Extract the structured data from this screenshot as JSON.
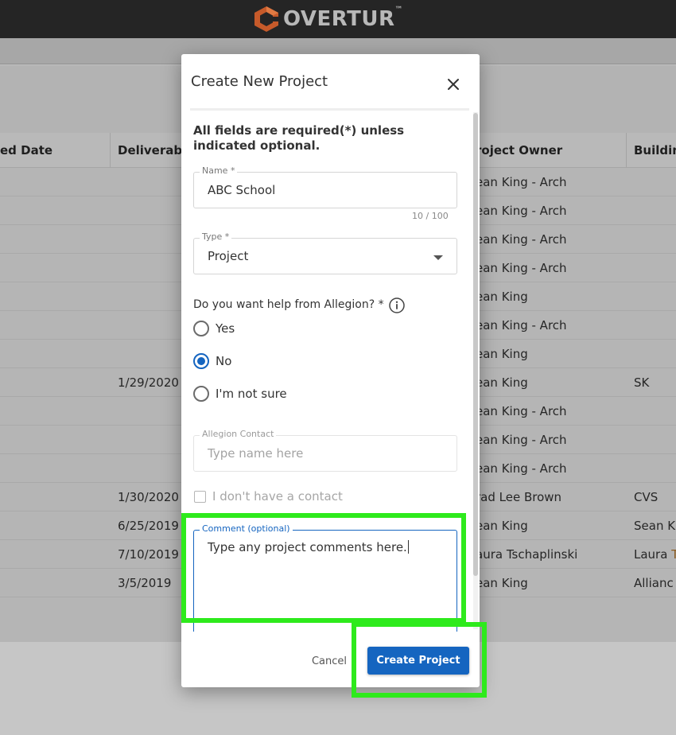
{
  "app": {
    "brand": "OVERTUR",
    "trademark": "™",
    "brand_color": "#c65a2a"
  },
  "table": {
    "headers": [
      "ed Date",
      "Deliverabl",
      "roject Owner",
      "Buildin"
    ],
    "rows": [
      {
        "deliverable": "",
        "owner": "ean King - Arch",
        "building": ""
      },
      {
        "deliverable": "",
        "owner": "ean King - Arch",
        "building": ""
      },
      {
        "deliverable": "",
        "owner": "ean King - Arch",
        "building": ""
      },
      {
        "deliverable": "",
        "owner": "ean King - Arch",
        "building": ""
      },
      {
        "deliverable": "",
        "owner": "ean King",
        "building": ""
      },
      {
        "deliverable": "",
        "owner": "ean King - Arch",
        "building": ""
      },
      {
        "deliverable": "",
        "owner": "ean King",
        "building": ""
      },
      {
        "deliverable": "1/29/2020",
        "owner": "ean King",
        "building": "SK"
      },
      {
        "deliverable": "",
        "owner": "ean King - Arch",
        "building": ""
      },
      {
        "deliverable": "",
        "owner": "ean King - Arch",
        "building": ""
      },
      {
        "deliverable": "",
        "owner": "ean King - Arch",
        "building": ""
      },
      {
        "deliverable": "1/30/2020",
        "owner": "rad Lee Brown",
        "building": "CVS"
      },
      {
        "deliverable": "6/25/2019",
        "owner": "ean King",
        "building": "Sean K"
      },
      {
        "deliverable": "7/10/2019",
        "owner": "aura Tschaplinski",
        "building": "Laura T"
      },
      {
        "deliverable": "3/5/2019",
        "owner": "ean King",
        "building": "Allianc"
      }
    ]
  },
  "modal": {
    "title": "Create New Project",
    "required_note": "All fields are required(*) unless indicated optional.",
    "name_field": {
      "label": "Name *",
      "value": "ABC School",
      "counter": "10 / 100"
    },
    "type_field": {
      "label": "Type *",
      "value": "Project"
    },
    "help_question": "Do you want help from Allegion? *",
    "help_options": [
      {
        "label": "Yes",
        "checked": false
      },
      {
        "label": "No",
        "checked": true
      },
      {
        "label": "I'm not sure",
        "checked": false
      }
    ],
    "contact_field": {
      "label": "Allegion Contact",
      "placeholder": "Type name here"
    },
    "no_contact_checkbox": {
      "label": "I don't have a contact",
      "checked": false
    },
    "comment_field": {
      "label": "Comment (optional)",
      "value": "Type any project comments here."
    },
    "cancel_label": "Cancel",
    "create_label": "Create Project"
  },
  "colors": {
    "primary": "#1565c0",
    "highlight": "#2eea1c"
  }
}
